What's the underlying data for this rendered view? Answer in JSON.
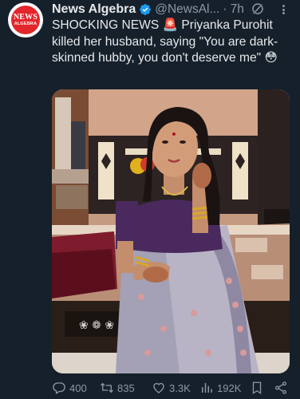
{
  "account": {
    "name": "News Algebra",
    "handle": "@NewsAl...",
    "separator": "·",
    "time": "7h",
    "avatar_text_1": "NEWS",
    "avatar_text_2": "ALGEBRA"
  },
  "post": {
    "text": "SHOCKING NEWS 🚨 Priyanka Purohit killed her husband, saying \"You are dark-skinned hubby, you don't deserve me\" 😳",
    "image_alt": "Woman in lavender saree sitting on a bed"
  },
  "actions": {
    "replies": "400",
    "reposts": "835",
    "likes": "3.3K",
    "views": "192K"
  },
  "colors": {
    "background": "#15202b",
    "text": "#e7e9ea",
    "muted": "#8b98a5",
    "verified": "#1d9bf0",
    "avatar_red": "#e3262b"
  },
  "icons": [
    "verified-badge-icon",
    "grok-icon",
    "more-icon",
    "reply-icon",
    "repost-icon",
    "like-icon",
    "views-icon",
    "bookmark-icon",
    "share-icon"
  ]
}
